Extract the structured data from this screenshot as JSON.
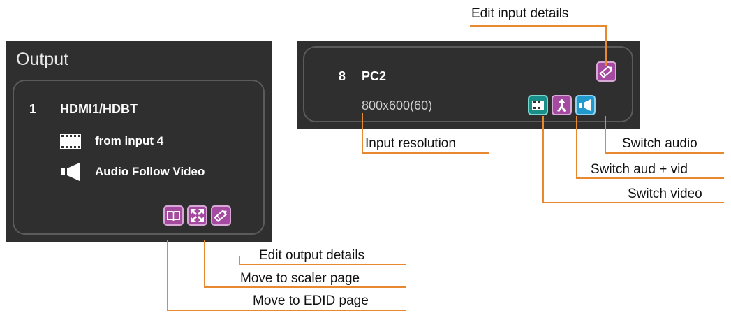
{
  "output_panel": {
    "title": "Output",
    "channel_number": "1",
    "channel_name": "HDMI1/HDBT",
    "video_source": "from input 4",
    "audio_mode": "Audio Follow Video",
    "buttons": [
      {
        "name": "edid-button",
        "icon": "book-icon",
        "color": "#a44aa0"
      },
      {
        "name": "scaler-button",
        "icon": "expand-icon",
        "color": "#a44aa0"
      },
      {
        "name": "edit-output-button",
        "icon": "pencil-icon",
        "color": "#a44aa0"
      }
    ]
  },
  "input_panel": {
    "channel_number": "8",
    "channel_name": "PC2",
    "resolution": "800x600(60)",
    "buttons": [
      {
        "name": "edit-input-button",
        "icon": "pencil-icon",
        "color": "#a44aa0"
      },
      {
        "name": "switch-video-button",
        "icon": "film-icon",
        "color": "#1a8f8a"
      },
      {
        "name": "switch-aud-vid-button",
        "icon": "merge-arrow-icon",
        "color": "#a44aa0"
      },
      {
        "name": "switch-audio-button",
        "icon": "speaker-icon",
        "color": "#2299cc"
      }
    ]
  },
  "callouts": {
    "edit_input_details": "Edit input details",
    "input_resolution": "Input resolution",
    "switch_audio": "Switch audio",
    "switch_aud_vid": "Switch aud + vid",
    "switch_video": "Switch video",
    "edit_output_details": "Edit output details",
    "move_to_scaler": "Move to scaler page",
    "move_to_edid": "Move to EDID page"
  },
  "colors": {
    "panel_bg": "#2f2f2f",
    "card_border": "#5b5b5b",
    "callout_line": "#e8892f"
  }
}
